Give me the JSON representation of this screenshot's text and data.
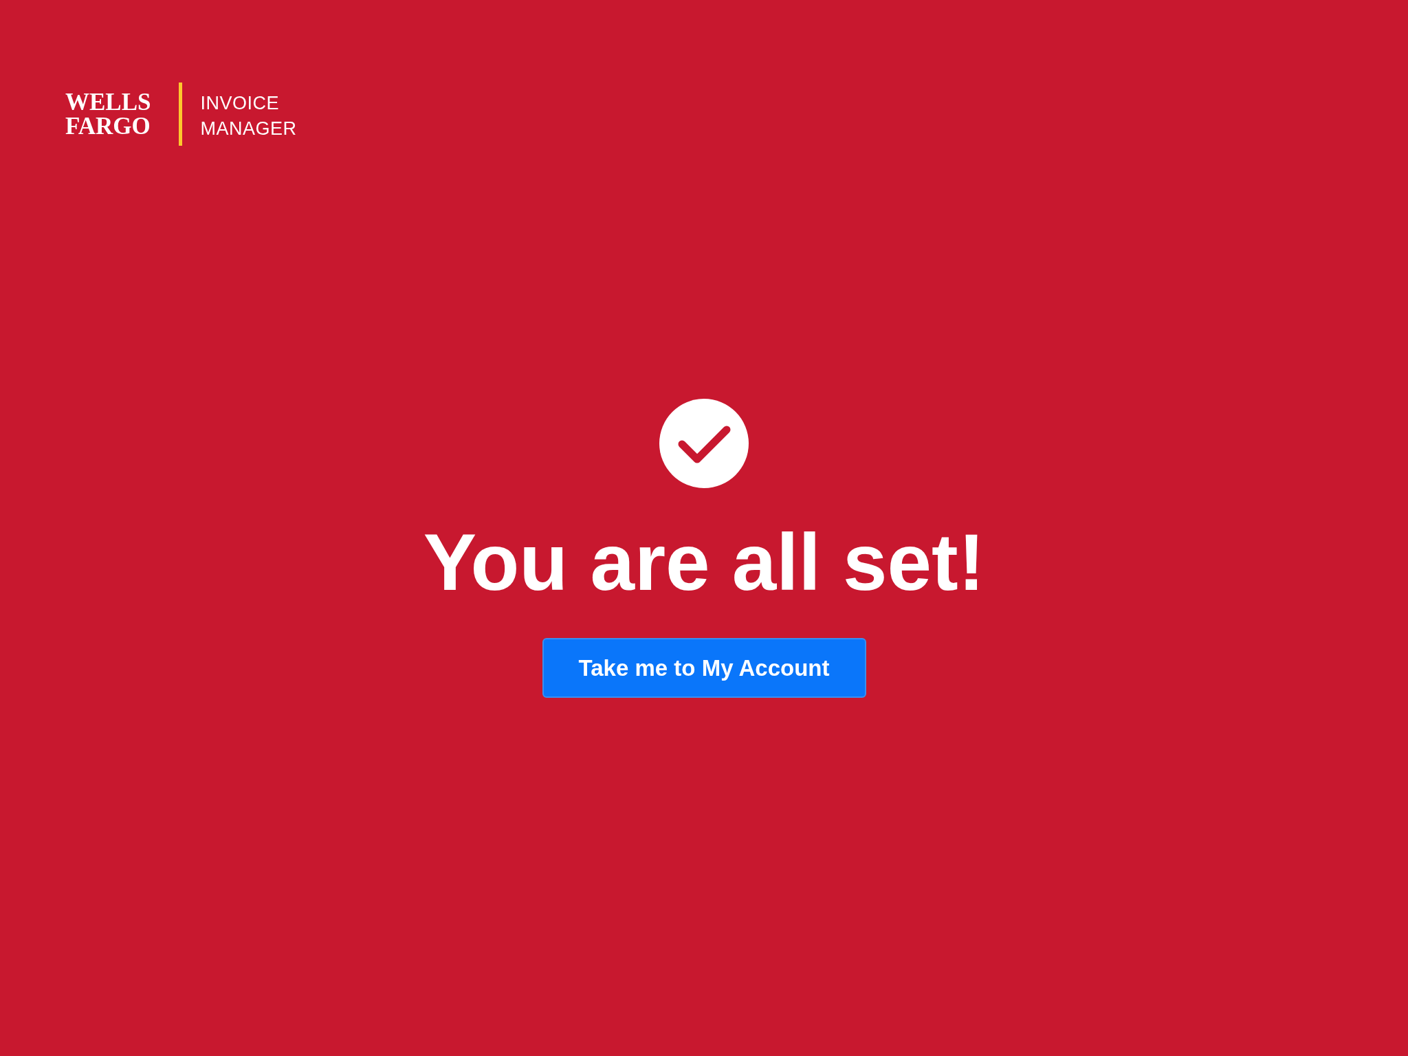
{
  "header": {
    "brand": "WELLS FARGO",
    "product": "INVOICE MANAGER"
  },
  "confirmation": {
    "title": "You are all set!",
    "button": "Take me to My Account"
  }
}
